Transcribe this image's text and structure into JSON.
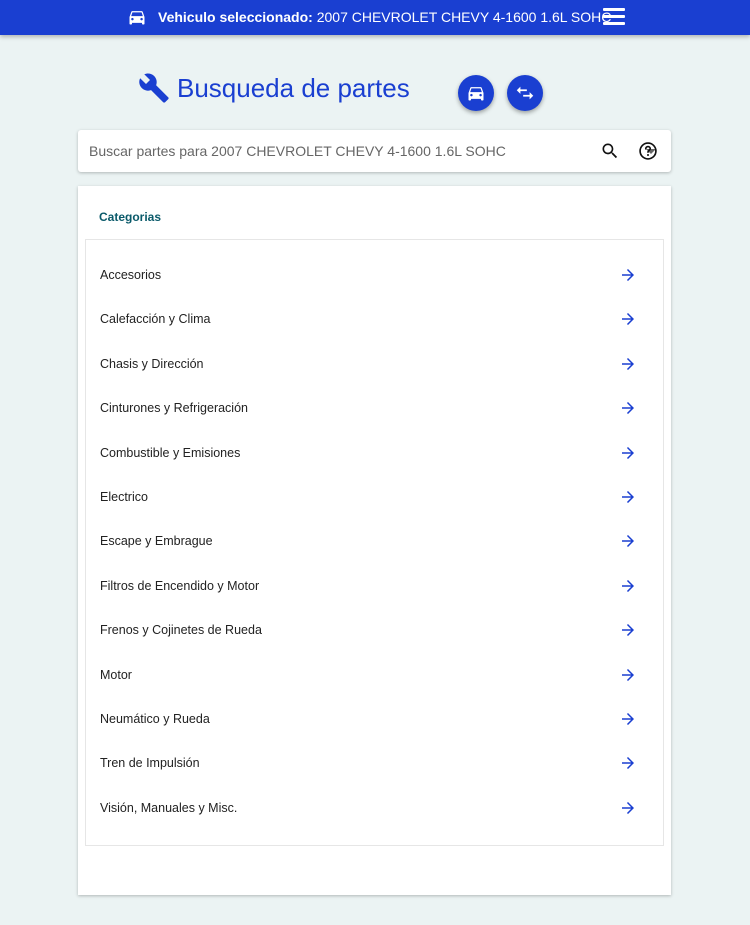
{
  "header": {
    "vehicle_label": "Vehiculo seleccionado:",
    "vehicle_value": " 2007 CHEVROLET CHEVY 4-1600 1.6L SOHC"
  },
  "title": "Busqueda de partes",
  "search": {
    "placeholder": "Buscar partes para 2007 CHEVROLET CHEVY 4-1600 1.6L SOHC"
  },
  "categories": {
    "title": "Categorias",
    "items": [
      {
        "label": "Accesorios"
      },
      {
        "label": "Calefacción y Clima"
      },
      {
        "label": "Chasis y Dirección"
      },
      {
        "label": "Cinturones y Refrigeración"
      },
      {
        "label": "Combustible y Emisiones"
      },
      {
        "label": "Electrico"
      },
      {
        "label": "Escape y Embrague"
      },
      {
        "label": "Filtros de Encendido y Motor"
      },
      {
        "label": "Frenos y Cojinetes de Rueda"
      },
      {
        "label": "Motor"
      },
      {
        "label": "Neumático y Rueda"
      },
      {
        "label": "Tren de Impulsión"
      },
      {
        "label": "Visión, Manuales y Misc."
      }
    ]
  },
  "colors": {
    "brand_blue": "#1a3fd1",
    "background": "#ebf3f3",
    "category_title": "#0a5a6a"
  },
  "icons": [
    "car-icon",
    "menu-icon",
    "wrench-icon",
    "swap-icon",
    "search-icon",
    "help-icon",
    "dropdown-caret-icon",
    "arrow-right-icon"
  ]
}
